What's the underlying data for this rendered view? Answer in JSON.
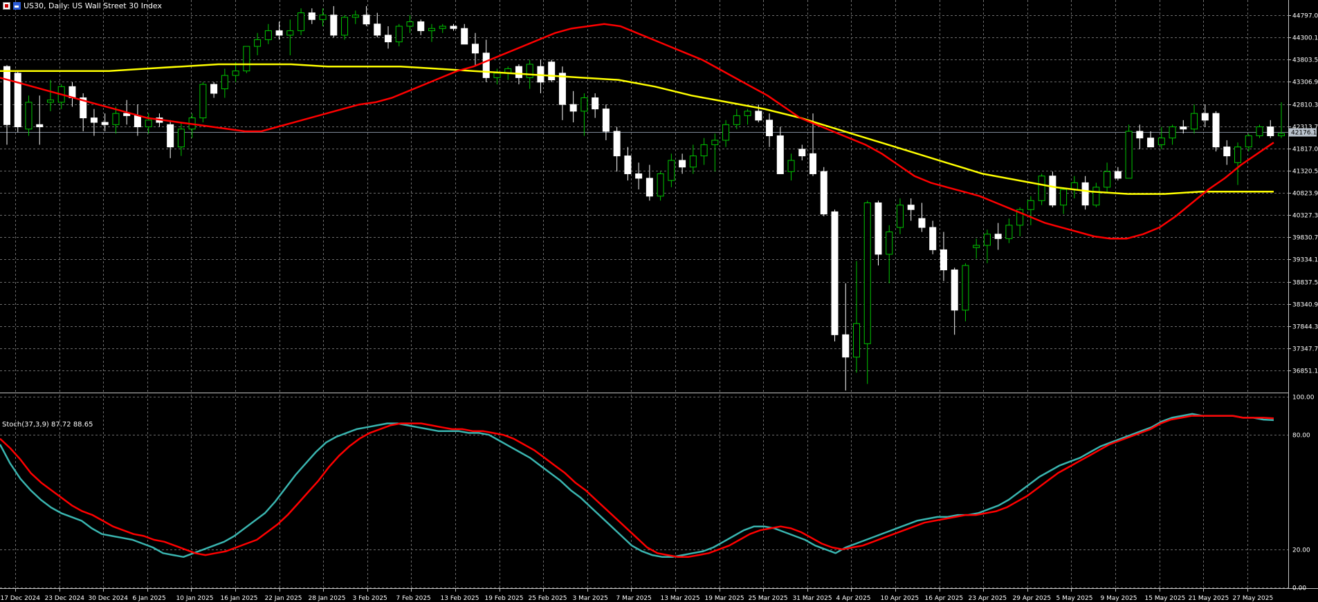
{
  "window": {
    "title": "US30, Daily:  US Wall Street 30 Index",
    "toolbar_icons": [
      "chart-window-icon",
      "chart-type-icon"
    ]
  },
  "price_axis": {
    "labels": [
      "44797.0",
      "44300.1",
      "43803.5",
      "43306.9",
      "42810.3",
      "42313.7",
      "41817.0",
      "41320.5",
      "40823.9",
      "40327.3",
      "39830.7",
      "39334.1",
      "38837.5",
      "38340.9",
      "37844.3",
      "37347.7",
      "36851.1"
    ],
    "current_price_label": "42176.1"
  },
  "stoch": {
    "label": "Stoch(37,3,9) 87.72 88.65",
    "axis_labels": [
      "100.00",
      "80.00",
      "20.00",
      "0.00"
    ]
  },
  "time_axis": {
    "labels": [
      "17 Dec 2024",
      "23 Dec 2024",
      "30 Dec 2024",
      "6 Jan 2025",
      "10 Jan 2025",
      "16 Jan 2025",
      "22 Jan 2025",
      "28 Jan 2025",
      "3 Feb 2025",
      "7 Feb 2025",
      "13 Feb 2025",
      "19 Feb 2025",
      "25 Feb 2025",
      "3 Mar 2025",
      "7 Mar 2025",
      "13 Mar 2025",
      "19 Mar 2025",
      "25 Mar 2025",
      "31 Mar 2025",
      "4 Apr 2025",
      "10 Apr 2025",
      "16 Apr 2025",
      "23 Apr 2025",
      "29 Apr 2025",
      "5 May 2025",
      "9 May 2025",
      "15 May 2025",
      "21 May 2025",
      "27 May 2025"
    ]
  },
  "colors": {
    "background": "#000000",
    "grid": "#6e6e6e",
    "bull_candle": "#00c800",
    "bear_candle": "#ffffff",
    "ma_fast": "#ff0000",
    "ma_slow": "#ffff00",
    "stoch_main": "#3ab5b0",
    "stoch_signal": "#ff0000",
    "current_price_line": "#7f8a99"
  },
  "chart_data": {
    "type": "candlestick",
    "symbol": "US30",
    "timeframe": "Daily",
    "ylim": [
      36400,
      45050
    ],
    "candles": [
      [
        43650,
        43680,
        41900,
        42350
      ],
      [
        43500,
        43550,
        42180,
        42300
      ],
      [
        42250,
        43000,
        42100,
        42850
      ],
      [
        42350,
        43000,
        41900,
        42300
      ],
      [
        42850,
        43350,
        42650,
        42900
      ],
      [
        42850,
        43250,
        42700,
        43200
      ],
      [
        43200,
        43300,
        42750,
        42950
      ],
      [
        42950,
        43050,
        42200,
        42500
      ],
      [
        42500,
        42700,
        42100,
        42400
      ],
      [
        42400,
        42600,
        42200,
        42350
      ],
      [
        42350,
        42750,
        42150,
        42600
      ],
      [
        42600,
        42900,
        42350,
        42550
      ],
      [
        42550,
        42800,
        42100,
        42300
      ],
      [
        42300,
        42600,
        42150,
        42450
      ],
      [
        42500,
        42600,
        42300,
        42400
      ],
      [
        42350,
        42450,
        41600,
        41850
      ],
      [
        41850,
        42400,
        41650,
        42250
      ],
      [
        42250,
        42600,
        42050,
        42500
      ],
      [
        42500,
        43300,
        42400,
        43250
      ],
      [
        43250,
        43300,
        42950,
        43050
      ],
      [
        43150,
        43600,
        42950,
        43450
      ],
      [
        43450,
        43750,
        43300,
        43550
      ],
      [
        43550,
        44100,
        43500,
        44100
      ],
      [
        44100,
        44400,
        43900,
        44250
      ],
      [
        44250,
        44600,
        44150,
        44450
      ],
      [
        44450,
        44650,
        44250,
        44350
      ],
      [
        44350,
        44700,
        43900,
        44450
      ],
      [
        44450,
        44950,
        44350,
        44850
      ],
      [
        44850,
        44950,
        44600,
        44700
      ],
      [
        44700,
        44950,
        44550,
        44800
      ],
      [
        44800,
        45000,
        44300,
        44350
      ],
      [
        44350,
        44800,
        44250,
        44750
      ],
      [
        44750,
        44900,
        44600,
        44800
      ],
      [
        44800,
        45000,
        44550,
        44600
      ],
      [
        44600,
        44850,
        44300,
        44350
      ],
      [
        44350,
        44550,
        44050,
        44200
      ],
      [
        44200,
        44600,
        44100,
        44550
      ],
      [
        44550,
        44800,
        44400,
        44650
      ],
      [
        44650,
        44700,
        44350,
        44450
      ],
      [
        44450,
        44600,
        44200,
        44500
      ],
      [
        44500,
        44600,
        44400,
        44550
      ],
      [
        44550,
        44600,
        44450,
        44500
      ],
      [
        44500,
        44600,
        44150,
        44150
      ],
      [
        44150,
        44400,
        43650,
        43950
      ],
      [
        43950,
        44250,
        43300,
        43400
      ],
      [
        43400,
        43600,
        43250,
        43500
      ],
      [
        43500,
        43650,
        43350,
        43600
      ],
      [
        43650,
        43700,
        43250,
        43400
      ],
      [
        43400,
        43800,
        43150,
        43700
      ],
      [
        43650,
        43800,
        43050,
        43300
      ],
      [
        43750,
        43800,
        43300,
        43350
      ],
      [
        43500,
        43650,
        42450,
        42800
      ],
      [
        42800,
        43100,
        42400,
        42650
      ],
      [
        42650,
        43050,
        42100,
        42950
      ],
      [
        42950,
        43050,
        42500,
        42700
      ],
      [
        42700,
        42800,
        42000,
        42200
      ],
      [
        42200,
        42300,
        41300,
        41650
      ],
      [
        41650,
        41850,
        41100,
        41250
      ],
      [
        41250,
        41500,
        40900,
        41150
      ],
      [
        41150,
        41450,
        40650,
        40750
      ],
      [
        40750,
        41300,
        40650,
        41250
      ],
      [
        41100,
        41700,
        40950,
        41550
      ],
      [
        41550,
        41700,
        41250,
        41400
      ],
      [
        41400,
        41900,
        41250,
        41650
      ],
      [
        41650,
        42050,
        41450,
        41900
      ],
      [
        41900,
        42150,
        41300,
        42000
      ],
      [
        42000,
        42450,
        41850,
        42350
      ],
      [
        42350,
        42700,
        42250,
        42550
      ],
      [
        42550,
        42700,
        42350,
        42650
      ],
      [
        42650,
        42800,
        42400,
        42450
      ],
      [
        42450,
        42600,
        41850,
        42100
      ],
      [
        42100,
        42300,
        41250,
        41250
      ],
      [
        41300,
        41700,
        41100,
        41550
      ],
      [
        41800,
        41900,
        41550,
        41650
      ],
      [
        41700,
        42600,
        41200,
        41250
      ],
      [
        41300,
        41400,
        40300,
        40350
      ],
      [
        40400,
        40450,
        37500,
        37650
      ],
      [
        37650,
        38800,
        36400,
        37150
      ],
      [
        37150,
        39300,
        36800,
        37900
      ],
      [
        37450,
        40650,
        36550,
        40600
      ],
      [
        40600,
        40650,
        39200,
        39450
      ],
      [
        39450,
        40100,
        38800,
        39950
      ],
      [
        40050,
        40700,
        39900,
        40550
      ],
      [
        40550,
        40700,
        40200,
        40450
      ],
      [
        40250,
        40600,
        39950,
        40050
      ],
      [
        40050,
        40200,
        39450,
        39550
      ],
      [
        39550,
        39950,
        38850,
        39100
      ],
      [
        39100,
        39150,
        37650,
        38200
      ],
      [
        38200,
        39250,
        37950,
        39200
      ],
      [
        39600,
        39800,
        39350,
        39650
      ],
      [
        39650,
        40000,
        39250,
        39900
      ],
      [
        39900,
        40150,
        39550,
        39800
      ],
      [
        39800,
        40250,
        39700,
        40100
      ],
      [
        40100,
        40500,
        39850,
        40450
      ],
      [
        40450,
        40750,
        40100,
        40650
      ],
      [
        40650,
        41250,
        40550,
        41200
      ],
      [
        41200,
        41300,
        40500,
        40550
      ],
      [
        40550,
        40950,
        40350,
        40900
      ],
      [
        40900,
        41200,
        40700,
        41050
      ],
      [
        41050,
        41200,
        40450,
        40550
      ],
      [
        40550,
        41050,
        40500,
        40950
      ],
      [
        40950,
        41500,
        40850,
        41300
      ],
      [
        41300,
        41400,
        41100,
        41150
      ],
      [
        41150,
        42350,
        41150,
        42200
      ],
      [
        42200,
        42350,
        41800,
        42050
      ],
      [
        42050,
        42200,
        41850,
        41850
      ],
      [
        41900,
        42300,
        41800,
        42050
      ],
      [
        42050,
        42350,
        41900,
        42300
      ],
      [
        42300,
        42450,
        42150,
        42250
      ],
      [
        42250,
        42800,
        42150,
        42600
      ],
      [
        42600,
        42800,
        42300,
        42450
      ],
      [
        42600,
        42650,
        41750,
        41850
      ],
      [
        41850,
        42000,
        41450,
        41650
      ],
      [
        41500,
        41950,
        41000,
        41850
      ],
      [
        41850,
        42150,
        41750,
        42100
      ],
      [
        42100,
        42350,
        42050,
        42300
      ],
      [
        42300,
        42450,
        42050,
        42100
      ],
      [
        42100,
        42850,
        42050,
        42150
      ]
    ],
    "ma_fast": [
      43400,
      43300,
      43200,
      43100,
      43000,
      42900,
      42800,
      42700,
      42600,
      42500,
      42450,
      42400,
      42350,
      42300,
      42250,
      42200,
      42200,
      42300,
      42400,
      42500,
      42600,
      42700,
      42800,
      42850,
      42950,
      43100,
      43250,
      43400,
      43550,
      43650,
      43800,
      43950,
      44100,
      44250,
      44400,
      44500,
      44550,
      44600,
      44550,
      44400,
      44250,
      44100,
      43950,
      43800,
      43600,
      43400,
      43200,
      43000,
      42750,
      42500,
      42350,
      42200,
      42050,
      41900,
      41700,
      41450,
      41200,
      41050,
      40950,
      40850,
      40750,
      40600,
      40450,
      40300,
      40150,
      40050,
      39950,
      39850,
      39800,
      39800,
      39900,
      40050,
      40300,
      40600,
      40900,
      41150,
      41450,
      41700,
      41950
    ],
    "ma_slow": [
      43550,
      43550,
      43550,
      43550,
      43600,
      43650,
      43700,
      43700,
      43700,
      43650,
      43650,
      43650,
      43600,
      43550,
      43500,
      43450,
      43400,
      43350,
      43200,
      43000,
      42850,
      42700,
      42500,
      42250,
      42000,
      41750,
      41500,
      41250,
      41100,
      40950,
      40850,
      40800,
      40800,
      40850,
      40850,
      40850
    ],
    "stoch_main": [
      75,
      65,
      57,
      51,
      46,
      42,
      39,
      37,
      35,
      31,
      28,
      27,
      26,
      25,
      23,
      21,
      18,
      17,
      16,
      18,
      20,
      22,
      24,
      27,
      31,
      35,
      39,
      45,
      52,
      59,
      65,
      71,
      76,
      79,
      81,
      83,
      84,
      85,
      86,
      86,
      85,
      84,
      83,
      82,
      82,
      82,
      81,
      81,
      80,
      77,
      74,
      71,
      68,
      64,
      60,
      56,
      51,
      47,
      42,
      37,
      32,
      27,
      22,
      19,
      17,
      16,
      16,
      17,
      18,
      19,
      21,
      24,
      27,
      30,
      32,
      32,
      31,
      29,
      27,
      25,
      22,
      20,
      18,
      21,
      23,
      25,
      27,
      29,
      31,
      33,
      35,
      36,
      37,
      37,
      38,
      38,
      39,
      41,
      43,
      46,
      50,
      54,
      58,
      61,
      64,
      66,
      68,
      71,
      74,
      76,
      78,
      80,
      82,
      84,
      87,
      89,
      90,
      91,
      90,
      90,
      90,
      90,
      89,
      89,
      88,
      87.72
    ],
    "stoch_signal": [
      78,
      73,
      67,
      60,
      55,
      51,
      47,
      43,
      40,
      38,
      35,
      32,
      30,
      28,
      27,
      25,
      24,
      22,
      20,
      18,
      17,
      18,
      19,
      21,
      23,
      25,
      29,
      33,
      38,
      44,
      50,
      56,
      63,
      69,
      74,
      78,
      81,
      83,
      85,
      86,
      86,
      86,
      85,
      84,
      83,
      83,
      82,
      82,
      81,
      80,
      78,
      75,
      72,
      68,
      64,
      60,
      55,
      51,
      46,
      41,
      36,
      31,
      26,
      21,
      18,
      17,
      16,
      16,
      17,
      18,
      20,
      22,
      25,
      28,
      30,
      31,
      32,
      31,
      29,
      26,
      23,
      21,
      20,
      21,
      22,
      24,
      26,
      28,
      30,
      32,
      34,
      35,
      36,
      37,
      38,
      38,
      39,
      40,
      42,
      45,
      48,
      52,
      56,
      60,
      63,
      66,
      69,
      72,
      75,
      77,
      79,
      81,
      83,
      86,
      88,
      89,
      90,
      90,
      90,
      90,
      90,
      89,
      89,
      89,
      88.65
    ]
  }
}
